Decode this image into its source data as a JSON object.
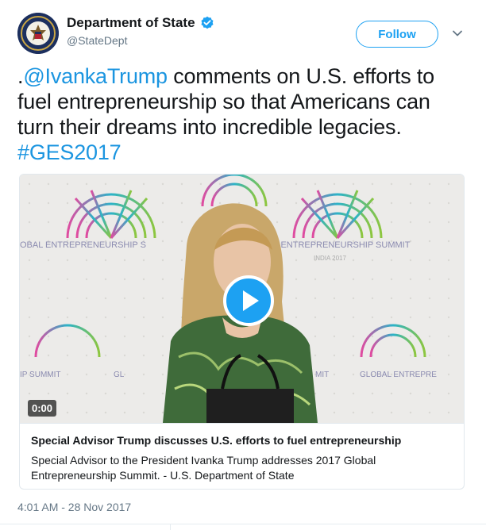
{
  "account": {
    "display_name": "Department of State",
    "handle": "@StateDept",
    "verified": true,
    "follow_label": "Follow",
    "avatar_icon": "state-department-seal"
  },
  "tweet": {
    "text_prefix": ".",
    "mention": "@IvankaTrump",
    "text_body": " comments on U.S. efforts to fuel entrepreneurship so that Americans can turn their dreams into incredible legacies. ",
    "hashtag": "#GES2017",
    "timestamp": "4:01 AM - 28 Nov 2017"
  },
  "media_card": {
    "duration": "0:00",
    "title": "Special Advisor Trump discusses U.S. efforts to fuel entrepreneurship",
    "description": "Special Advisor to the President Ivanka Trump addresses 2017 Global Entrepreneurship Summit. - U.S. Department of State",
    "backdrop_text_left": "OBAL ENTREPRENEURSHIP S",
    "backdrop_text_right": "BAL ENTREPRENEURSHIP SUMMIT",
    "backdrop_year": "INDIA 2017",
    "backdrop_text_bottom_left": "IP SUMMIT",
    "backdrop_text_bottom_mid": "GL",
    "backdrop_text_bottom_mid2": "MIT",
    "backdrop_text_bottom_right": "GLOBAL ENTREPRE"
  },
  "colors": {
    "accent": "#1da1f2",
    "link": "#1b95e0",
    "muted": "#657786"
  }
}
